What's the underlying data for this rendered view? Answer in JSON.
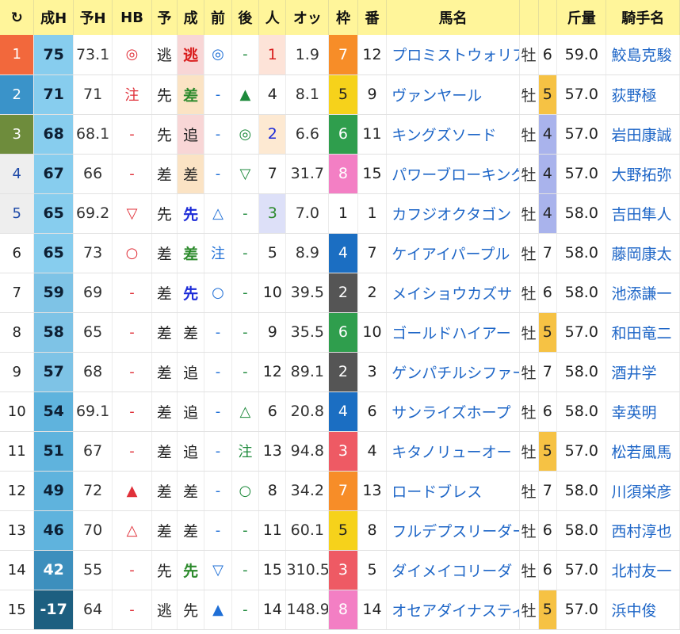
{
  "header": {
    "reload_icon": "↻",
    "cols": [
      "成H",
      "予H",
      "HB",
      "予",
      "成",
      "前",
      "後",
      "人",
      "オッ",
      "枠",
      "番",
      "馬名",
      "斤量",
      "騎手名"
    ]
  },
  "colors": {
    "header_bg": "#fff59a",
    "name_link": "#1e66c7",
    "rank_bg": [
      "#f2683c",
      "#3a93c9",
      "#6e8c3c",
      "#eeeeee",
      "#eeeeee"
    ],
    "waku_bg": {
      "1": "#ffffff",
      "2": "#555555",
      "3": "#ee5a64",
      "4": "#1b6ec2",
      "5": "#f6d21b",
      "6": "#2f9e4d",
      "7": "#f78d28",
      "8": "#f37fc4"
    }
  },
  "rows": [
    {
      "rank": "1",
      "seih": "75",
      "predh": "73.1",
      "hb": "◎",
      "yo": "逃",
      "sei": "逃",
      "mae": "◎",
      "ato": "-",
      "ninki": "1",
      "odds": "1.9",
      "waku": "7",
      "ban": "12",
      "name": "プロミストウォリア",
      "sex": "牡",
      "age": "6",
      "kin": "59.0",
      "jockey": "鮫島克駿"
    },
    {
      "rank": "2",
      "seih": "71",
      "predh": "71",
      "hb": "注",
      "yo": "先",
      "sei": "差",
      "mae": "-",
      "ato": "▲",
      "ninki": "4",
      "odds": "8.1",
      "waku": "5",
      "ban": "9",
      "name": "ヴァンヤール",
      "sex": "牡",
      "age": "5",
      "kin": "57.0",
      "jockey": "荻野極"
    },
    {
      "rank": "3",
      "seih": "68",
      "predh": "68.1",
      "hb": "-",
      "yo": "先",
      "sei": "追",
      "mae": "-",
      "ato": "◎",
      "ninki": "2",
      "odds": "6.6",
      "waku": "6",
      "ban": "11",
      "name": "キングズソード",
      "sex": "牡",
      "age": "4",
      "kin": "57.0",
      "jockey": "岩田康誠"
    },
    {
      "rank": "4",
      "seih": "67",
      "predh": "66",
      "hb": "-",
      "yo": "差",
      "sei": "差",
      "mae": "-",
      "ato": "▽",
      "ninki": "7",
      "odds": "31.7",
      "waku": "8",
      "ban": "15",
      "name": "パワーブローキング",
      "sex": "牡",
      "age": "4",
      "kin": "57.0",
      "jockey": "大野拓弥"
    },
    {
      "rank": "5",
      "seih": "65",
      "predh": "69.2",
      "hb": "▽",
      "yo": "先",
      "sei": "先",
      "mae": "△",
      "ato": "-",
      "ninki": "3",
      "odds": "7.0",
      "waku": "1",
      "ban": "1",
      "name": "カフジオクタゴン",
      "sex": "牡",
      "age": "4",
      "kin": "58.0",
      "jockey": "吉田隼人"
    },
    {
      "rank": "6",
      "seih": "65",
      "predh": "73",
      "hb": "○",
      "yo": "差",
      "sei": "差",
      "mae": "注",
      "ato": "-",
      "ninki": "5",
      "odds": "8.9",
      "waku": "4",
      "ban": "7",
      "name": "ケイアイパープル",
      "sex": "牡",
      "age": "7",
      "kin": "58.0",
      "jockey": "藤岡康太"
    },
    {
      "rank": "7",
      "seih": "59",
      "predh": "69",
      "hb": "-",
      "yo": "差",
      "sei": "先",
      "mae": "○",
      "ato": "-",
      "ninki": "10",
      "odds": "39.5",
      "waku": "2",
      "ban": "2",
      "name": "メイショウカズサ",
      "sex": "牡",
      "age": "6",
      "kin": "58.0",
      "jockey": "池添謙一"
    },
    {
      "rank": "8",
      "seih": "58",
      "predh": "65",
      "hb": "-",
      "yo": "差",
      "sei": "差",
      "mae": "-",
      "ato": "-",
      "ninki": "9",
      "odds": "35.5",
      "waku": "6",
      "ban": "10",
      "name": "ゴールドハイアー",
      "sex": "牡",
      "age": "5",
      "kin": "57.0",
      "jockey": "和田竜二"
    },
    {
      "rank": "9",
      "seih": "57",
      "predh": "68",
      "hb": "-",
      "yo": "差",
      "sei": "追",
      "mae": "-",
      "ato": "-",
      "ninki": "12",
      "odds": "89.1",
      "waku": "2",
      "ban": "3",
      "name": "ゲンパチルシファー",
      "sex": "牡",
      "age": "7",
      "kin": "58.0",
      "jockey": "酒井学"
    },
    {
      "rank": "10",
      "seih": "54",
      "predh": "69.1",
      "hb": "-",
      "yo": "差",
      "sei": "追",
      "mae": "-",
      "ato": "△",
      "ninki": "6",
      "odds": "20.8",
      "waku": "4",
      "ban": "6",
      "name": "サンライズホープ",
      "sex": "牡",
      "age": "6",
      "kin": "58.0",
      "jockey": "幸英明"
    },
    {
      "rank": "11",
      "seih": "51",
      "predh": "67",
      "hb": "-",
      "yo": "差",
      "sei": "追",
      "mae": "-",
      "ato": "注",
      "ninki": "13",
      "odds": "94.8",
      "waku": "3",
      "ban": "4",
      "name": "キタノリューオー",
      "sex": "牡",
      "age": "5",
      "kin": "57.0",
      "jockey": "松若風馬"
    },
    {
      "rank": "12",
      "seih": "49",
      "predh": "72",
      "hb": "▲",
      "yo": "差",
      "sei": "差",
      "mae": "-",
      "ato": "○",
      "ninki": "8",
      "odds": "34.2",
      "waku": "7",
      "ban": "13",
      "name": "ロードブレス",
      "sex": "牡",
      "age": "7",
      "kin": "58.0",
      "jockey": "川須栄彦"
    },
    {
      "rank": "13",
      "seih": "46",
      "predh": "70",
      "hb": "△",
      "yo": "差",
      "sei": "差",
      "mae": "-",
      "ato": "-",
      "ninki": "11",
      "odds": "60.1",
      "waku": "5",
      "ban": "8",
      "name": "フルデプスリーダー",
      "sex": "牡",
      "age": "6",
      "kin": "58.0",
      "jockey": "西村淳也"
    },
    {
      "rank": "14",
      "seih": "42",
      "predh": "55",
      "hb": "-",
      "yo": "先",
      "sei": "先",
      "mae": "▽",
      "ato": "-",
      "ninki": "15",
      "odds": "310.5",
      "waku": "3",
      "ban": "5",
      "name": "ダイメイコリーダ",
      "sex": "牡",
      "age": "6",
      "kin": "57.0",
      "jockey": "北村友一"
    },
    {
      "rank": "15",
      "seih": "-17",
      "predh": "64",
      "hb": "-",
      "yo": "逃",
      "sei": "先",
      "mae": "▲",
      "ato": "-",
      "ninki": "14",
      "odds": "148.9",
      "waku": "8",
      "ban": "14",
      "name": "オセアダイナスティ",
      "sex": "牡",
      "age": "5",
      "kin": "57.0",
      "jockey": "浜中俊"
    }
  ]
}
